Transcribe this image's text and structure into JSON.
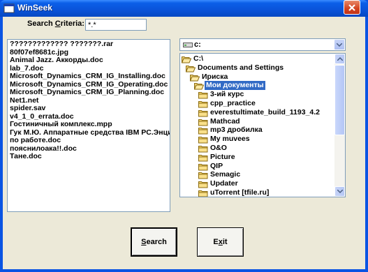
{
  "window": {
    "title": "WinSeek",
    "colors": {
      "titlebar": "#0a53d9",
      "client": "#ece9d8",
      "selection": "#316ac5"
    }
  },
  "criteria": {
    "label_prefix": "Search ",
    "label_access": "C",
    "label_suffix": "riteria:",
    "value": "*.*"
  },
  "files": [
    "????????????? ???????.rar",
    "80f07ef8681c.jpg",
    "Animal Jazz. Аккорды.doc",
    "lab_7.doc",
    "Microsoft_Dynamics_CRM_IG_Installing.doc",
    "Microsoft_Dynamics_CRM_IG_Operating.doc",
    "Microsoft_Dynamics_CRM_IG_Planning.doc",
    "Net1.net",
    "spider.sav",
    "v4_1_0_errata.doc",
    "Гостиничный комплекс.mpp",
    "Гук М.Ю. Аппаратные средства IBM PC.Энци",
    "по работе.doc",
    "пояснилоакa!!.doc",
    "Тане.doc"
  ],
  "drive": {
    "value": "c:"
  },
  "directories": [
    {
      "name": "C:\\",
      "open": true
    },
    {
      "name": "Documents and Settings",
      "open": true
    },
    {
      "name": "Ириска",
      "open": true
    },
    {
      "name": "Мои документы",
      "open": true
    },
    {
      "name": "3-ий курс",
      "open": false
    },
    {
      "name": "cpp_practice",
      "open": false
    },
    {
      "name": "everestultimate_build_1193_4.2",
      "open": false
    },
    {
      "name": "Mathcad",
      "open": false
    },
    {
      "name": "mp3 дробилка",
      "open": false
    },
    {
      "name": "My muvees",
      "open": false
    },
    {
      "name": "O&O",
      "open": false
    },
    {
      "name": "Picture",
      "open": false
    },
    {
      "name": "QIP",
      "open": false
    },
    {
      "name": "Semagic",
      "open": false
    },
    {
      "name": "Updater",
      "open": false
    },
    {
      "name": "uTorrent [tfile.ru]",
      "open": false
    }
  ],
  "buttons": {
    "search_access": "S",
    "search_rest": "earch",
    "exit_prefix": "E",
    "exit_access": "x",
    "exit_suffix": "it"
  }
}
